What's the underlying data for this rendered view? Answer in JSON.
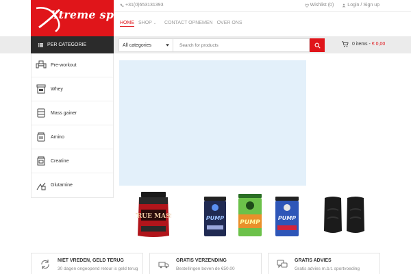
{
  "logo": {
    "text": "Xtreme sport"
  },
  "topbar": {
    "phone": "+31(0)653131393",
    "wishlist": "Wishlist (0)",
    "login": "Login / Sign up"
  },
  "nav": {
    "home": "HOME",
    "shop": "SHOP",
    "contact": "CONTACT OPNEMEN",
    "about": "OVER ONS"
  },
  "category_button": {
    "label": "PER CATEGORIE"
  },
  "search": {
    "category_select": "All categories",
    "placeholder": "Search for products"
  },
  "cart": {
    "items": "0 items",
    "separator": "-",
    "total": "€ 0,00"
  },
  "sidebar": {
    "items": [
      {
        "label": "Pre-workout",
        "icon": "pre-workout-icon"
      },
      {
        "label": "Whey",
        "icon": "whey-icon"
      },
      {
        "label": "Mass gainer",
        "icon": "mass-gainer-icon"
      },
      {
        "label": "Amino",
        "icon": "amino-icon"
      },
      {
        "label": "Creatine",
        "icon": "creatine-icon"
      },
      {
        "label": "Glutamine",
        "icon": "glutamine-icon"
      }
    ]
  },
  "products": [
    {
      "label": "TRUE MASS",
      "icon": "true-mass-tub-image"
    },
    {
      "label": "PUMP",
      "icon": "pump-tub-blue-image"
    },
    {
      "label": "PUMP",
      "icon": "pump-tub-green-image"
    },
    {
      "label": "PUMP",
      "icon": "pump-tub-red-image"
    },
    {
      "label": "",
      "icon": "black-knee-sleeves-image"
    }
  ],
  "features": [
    {
      "title": "NIET VREDEN, GELD TERUG",
      "desc": "30 dagen ongeopend retour is geld terug",
      "icon": "refresh-icon"
    },
    {
      "title": "GRATIS VERZENDING",
      "desc": "Bestellingen boven de €50.00",
      "icon": "truck-icon"
    },
    {
      "title": "GRATIS ADVIES",
      "desc": "Gratis advies m.b.t. sportvoeding",
      "icon": "chat-icon"
    }
  ],
  "colors": {
    "brand_red": "#e0151a",
    "dark": "#2b2b2b",
    "banner_bg": "#e3f0fa",
    "bar_bg": "#ebebeb"
  }
}
